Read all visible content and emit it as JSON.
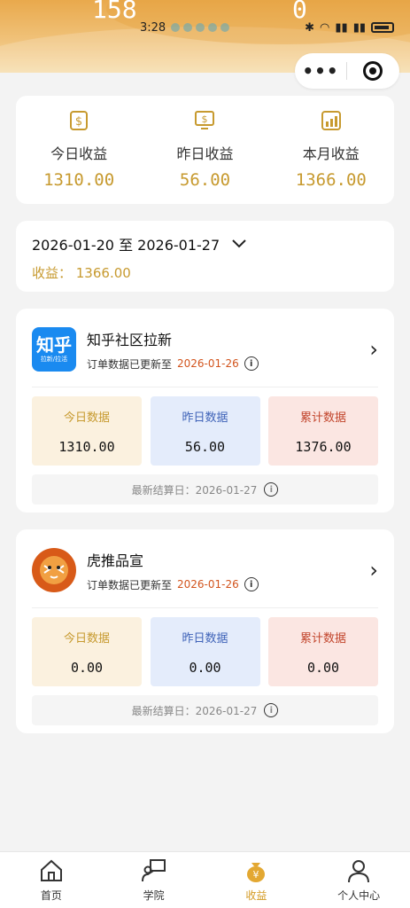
{
  "header": {
    "big_left": "158",
    "big_right": "0"
  },
  "status": {
    "time": "3:28"
  },
  "capsule": {
    "menu_glyph": "•••"
  },
  "summary": [
    {
      "icon": "dollar-coin-icon",
      "label": "今日收益",
      "value": "1310.00"
    },
    {
      "icon": "dollar-monitor-icon",
      "label": "昨日收益",
      "value": "56.00"
    },
    {
      "icon": "chart-up-icon",
      "label": "本月收益",
      "value": "1366.00"
    }
  ],
  "range": {
    "text": "2026-01-20 至 2026-01-27",
    "income": "收益： 1366.00"
  },
  "platforms": [
    {
      "name": "知乎社区拉新",
      "logo_text": "知乎",
      "logo_sub": "拉新/拉活",
      "update_prefix": "订单数据已更新至",
      "update_date": "2026-01-26",
      "today_label": "今日数据",
      "today_value": "1310.00",
      "yest_label": "昨日数据",
      "yest_value": "56.00",
      "total_label": "累计数据",
      "total_value": "1376.00",
      "settle": "最新结算日：2026-01-27"
    },
    {
      "name": "虎推品宣",
      "update_prefix": "订单数据已更新至",
      "update_date": "2026-01-26",
      "today_label": "今日数据",
      "today_value": "0.00",
      "yest_label": "昨日数据",
      "yest_value": "0.00",
      "total_label": "累计数据",
      "total_value": "0.00",
      "settle": "最新结算日：2026-01-27"
    }
  ],
  "tabs": [
    {
      "label": "首页",
      "icon": "home-icon"
    },
    {
      "label": "学院",
      "icon": "teacher-board-icon"
    },
    {
      "label": "收益",
      "icon": "money-bag-icon",
      "active": true
    },
    {
      "label": "个人中心",
      "icon": "person-icon"
    }
  ],
  "colors": {
    "accent": "#c79a2f",
    "date_red": "#d2541d",
    "zhihu_blue": "#1a8af0"
  }
}
